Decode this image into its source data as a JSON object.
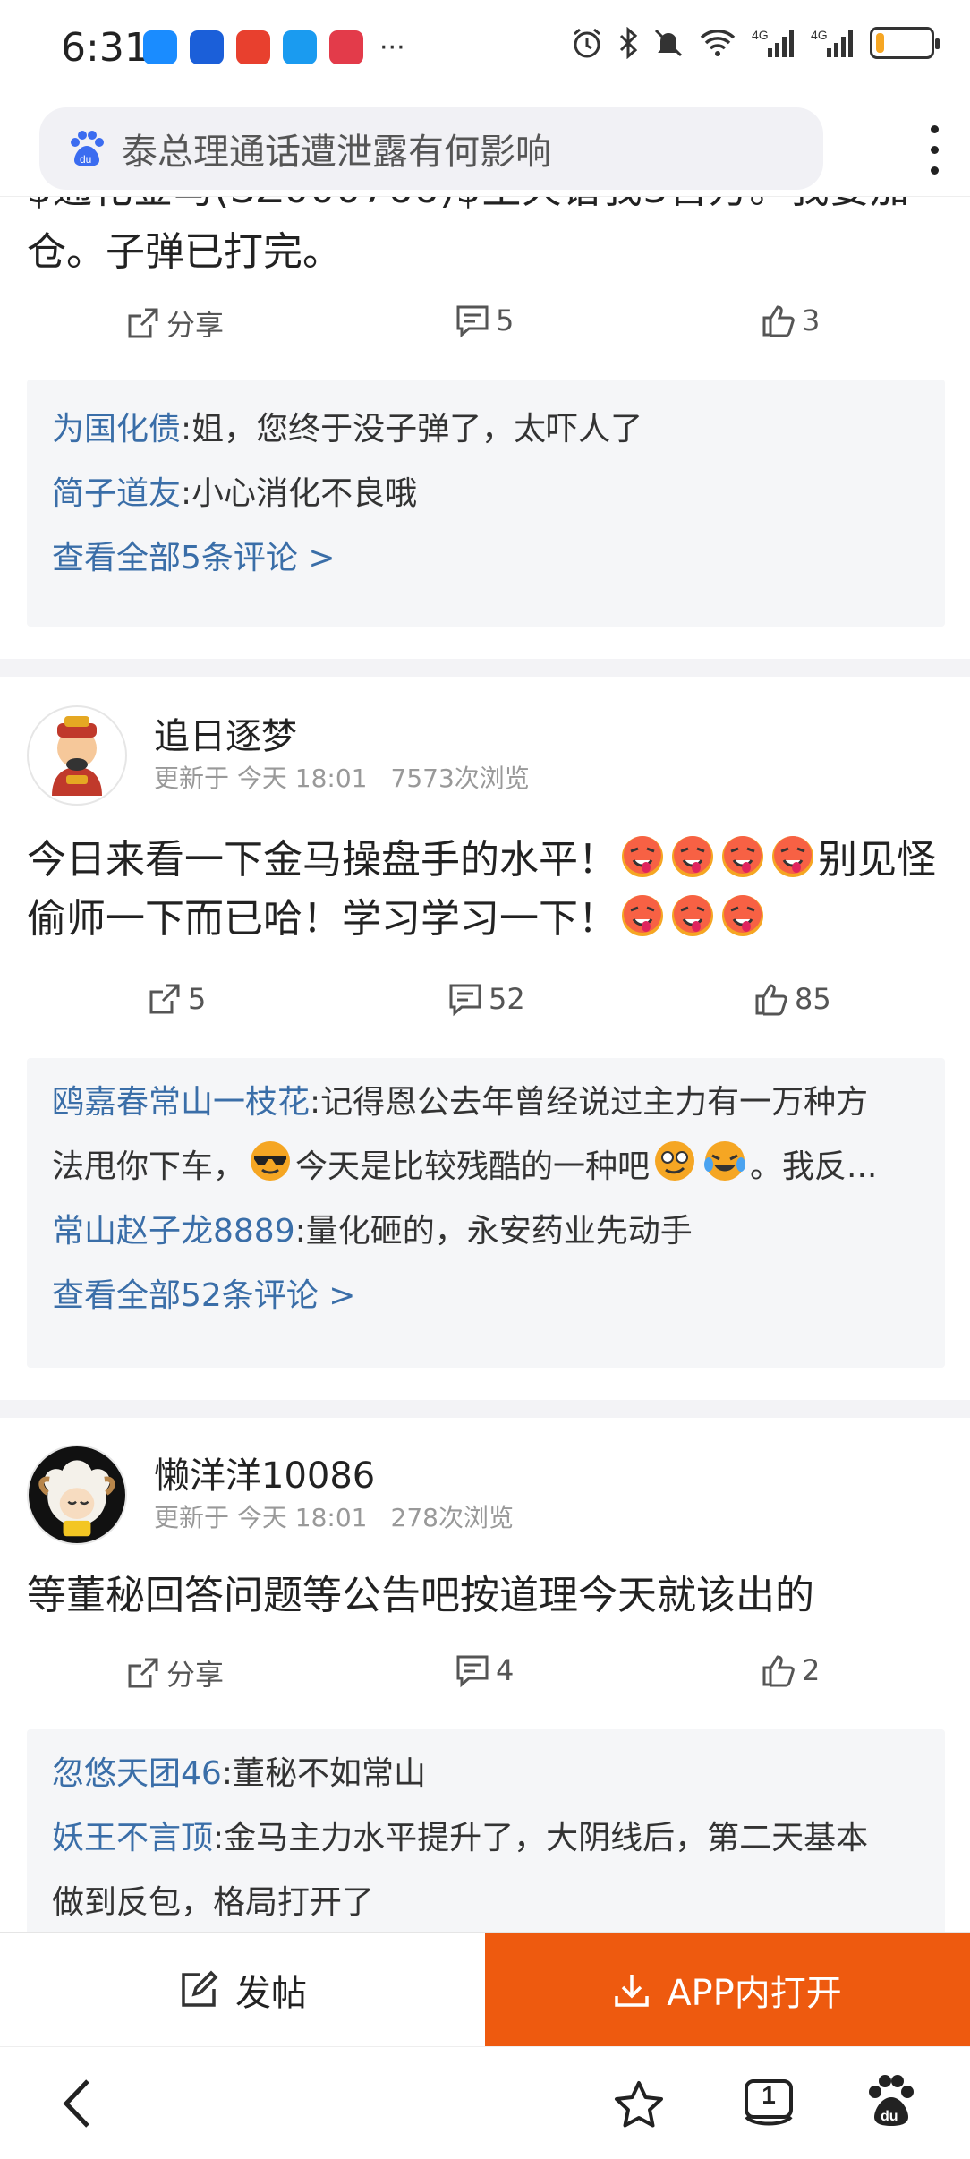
{
  "status_bar": {
    "time": "6:31",
    "more": "···",
    "app_icon_colors": [
      "#1a8cff",
      "#1b5fd9",
      "#e8402e",
      "#1a9bf0",
      "#e33b4a"
    ],
    "icons": [
      "alarm-icon",
      "bluetooth-icon",
      "mute-icon",
      "wifi-icon",
      "signal-4g-icon",
      "signal-4g-icon",
      "battery-icon"
    ],
    "battery_level": 0.15
  },
  "search": {
    "query": "泰总理通话遭泄露有何影响"
  },
  "post1": {
    "text_cut": "仓。子弹已打完。",
    "share_label": "分享",
    "comment_count": "5",
    "like_count": "3",
    "comments": [
      {
        "user": "为国化债",
        "text": ":姐，您终于没子弹了，太吓人了"
      },
      {
        "user": "简子道友",
        "text": ":小心消化不良哦"
      }
    ],
    "view_all": "查看全部5条评论 >"
  },
  "post2": {
    "username": "追日逐梦",
    "updated": "更新于 今天 18:01",
    "views": "7573次浏览",
    "text_a": "今日来看一下金马操盘手的水平！",
    "text_b": "别见怪偷师一下而已哈！学习学习一下！",
    "share_count": "5",
    "comment_count": "52",
    "like_count": "85",
    "comments": [
      {
        "user": "鸥嘉春常山一枝花",
        "text": ":记得恩公去年曾经说过主力有一万种方"
      },
      {
        "user": "",
        "text": "法甩你下车，",
        "text2": "今天是比较残酷的一种吧",
        "text3": "。我反..."
      },
      {
        "user": "常山赵子龙8889",
        "text": ":量化砸的，永安药业先动手"
      }
    ],
    "view_all": "查看全部52条评论 >"
  },
  "post3": {
    "username": "懒洋洋10086",
    "updated": "更新于 今天 18:01",
    "views": "278次浏览",
    "text": "等董秘回答问题等公告吧按道理今天就该出的",
    "share_label": "分享",
    "comment_count": "4",
    "like_count": "2",
    "comments": [
      {
        "user": "忽悠天团46",
        "text": ":董秘不如常山"
      },
      {
        "user": "妖王不言顶",
        "text": ":金马主力水平提升了，大阴线后，第二天基本"
      },
      {
        "user": "",
        "text": "做到反包，格局打开了"
      }
    ]
  },
  "bottom_bar": {
    "post_label": "发帖",
    "open_app_label": "APP内打开",
    "open_app_color": "#ee5a0f"
  },
  "nav": {
    "tab_count": "1"
  }
}
